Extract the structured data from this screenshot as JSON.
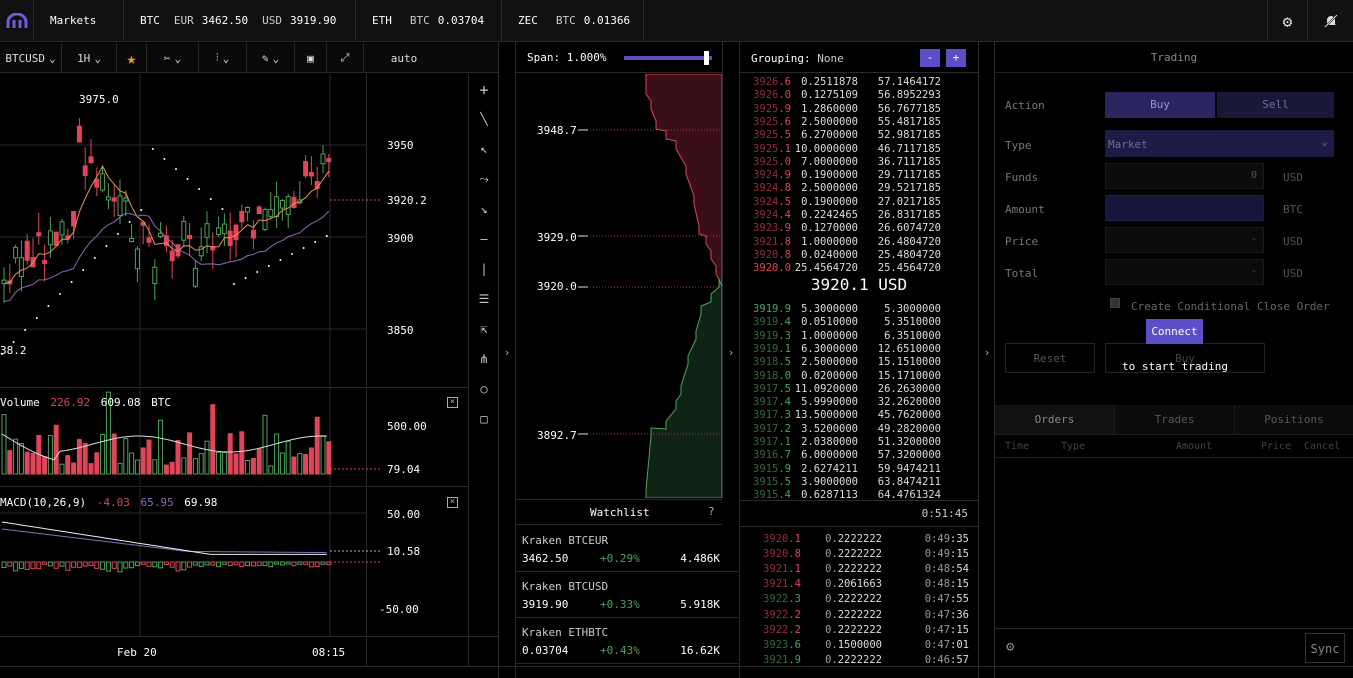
{
  "topbar": {
    "markets_label": "Markets",
    "btc": {
      "label": "BTC",
      "eur_label": "EUR",
      "eur_value": "3462.50",
      "usd_label": "USD",
      "usd_value": "3919.90"
    },
    "eth": {
      "label": "ETH",
      "btc_label": "BTC",
      "btc_value": "0.03704"
    },
    "zec": {
      "label": "ZEC",
      "btc_label": "BTC",
      "btc_value": "0.01366"
    }
  },
  "chart_toolbar": {
    "pair": "BTCUSD",
    "interval": "1H",
    "scale": "auto"
  },
  "price_chart": {
    "high_label": "3975.0",
    "low_label": "38.2",
    "axis_ticks": [
      "3950",
      "3920.2",
      "3900",
      "3850"
    ],
    "x_ticks": [
      "Feb 20",
      "08:15"
    ]
  },
  "volume": {
    "label": "Volume",
    "v1": "226.92",
    "v2": "609.08",
    "unit": "BTC",
    "ticks": [
      "500.00",
      "79.04"
    ]
  },
  "macd": {
    "label": "MACD(10,26,9)",
    "v1": "-4.03",
    "v2": "65.95",
    "v3": "69.98",
    "ticks": [
      "50.00",
      "10.58",
      "-50.00"
    ]
  },
  "depth": {
    "span_label": "Span:",
    "span_value": "1.000%",
    "ticks": [
      "3948.7",
      "3929.0",
      "3920.0",
      "3892.7"
    ]
  },
  "watchlist": {
    "title": "Watchlist",
    "help": "?",
    "items": [
      {
        "name": "Kraken BTCEUR",
        "price": "3462.50",
        "change": "+0.29%",
        "volume": "4.486K"
      },
      {
        "name": "Kraken BTCUSD",
        "price": "3919.90",
        "change": "+0.33%",
        "volume": "5.918K"
      },
      {
        "name": "Kraken ETHBTC",
        "price": "0.03704",
        "change": "+0.43%",
        "volume": "16.62K"
      }
    ]
  },
  "orderbook": {
    "grouping_label": "Grouping:",
    "grouping_value": "None",
    "minus": "-",
    "plus": "+",
    "mid_price": "3920.1 USD",
    "asks": [
      [
        "3926.6",
        "0.2511878",
        "57.1464172"
      ],
      [
        "3926.0",
        "0.1275109",
        "56.8952293"
      ],
      [
        "3925.9",
        "1.2860000",
        "56.7677185"
      ],
      [
        "3925.6",
        "2.5000000",
        "55.4817185"
      ],
      [
        "3925.5",
        "6.2700000",
        "52.9817185"
      ],
      [
        "3925.1",
        "10.0000000",
        "46.7117185"
      ],
      [
        "3925.0",
        "7.0000000",
        "36.7117185"
      ],
      [
        "3924.9",
        "0.1900000",
        "29.7117185"
      ],
      [
        "3924.8",
        "2.5000000",
        "29.5217185"
      ],
      [
        "3924.5",
        "0.1900000",
        "27.0217185"
      ],
      [
        "3924.4",
        "0.2242465",
        "26.8317185"
      ],
      [
        "3923.9",
        "0.1270000",
        "26.6074720"
      ],
      [
        "3921.8",
        "1.0000000",
        "26.4804720"
      ],
      [
        "3920.8",
        "0.0240000",
        "25.4804720"
      ],
      [
        "3920.0",
        "25.4564720",
        "25.4564720"
      ]
    ],
    "bids": [
      [
        "3919.9",
        "5.3000000",
        "5.3000000"
      ],
      [
        "3919.4",
        "0.0510000",
        "5.3510000"
      ],
      [
        "3919.3",
        "1.0000000",
        "6.3510000"
      ],
      [
        "3919.1",
        "6.3000000",
        "12.6510000"
      ],
      [
        "3918.5",
        "2.5000000",
        "15.1510000"
      ],
      [
        "3918.0",
        "0.0200000",
        "15.1710000"
      ],
      [
        "3917.5",
        "11.0920000",
        "26.2630000"
      ],
      [
        "3917.4",
        "5.9990000",
        "32.2620000"
      ],
      [
        "3917.3",
        "13.5000000",
        "45.7620000"
      ],
      [
        "3917.2",
        "3.5200000",
        "49.2820000"
      ],
      [
        "3917.1",
        "2.0380000",
        "51.3200000"
      ],
      [
        "3916.7",
        "6.0000000",
        "57.3200000"
      ],
      [
        "3915.9",
        "2.6274211",
        "59.9474211"
      ],
      [
        "3915.5",
        "3.9000000",
        "63.8474211"
      ],
      [
        "3915.4",
        "0.6287113",
        "64.4761324"
      ]
    ]
  },
  "trades": {
    "time_header": "0:51:45",
    "rows": [
      {
        "price": "3920.1",
        "amount": "0.2222222",
        "time": "0:49:35",
        "side": "sell"
      },
      {
        "price": "3920.8",
        "amount": "0.2222222",
        "time": "0:49:15",
        "side": "sell"
      },
      {
        "price": "3921.1",
        "amount": "0.2222222",
        "time": "0:48:54",
        "side": "sell"
      },
      {
        "price": "3921.4",
        "amount": "0.2061663",
        "time": "0:48:15",
        "side": "sell"
      },
      {
        "price": "3922.3",
        "amount": "0.2222222",
        "time": "0:47:55",
        "side": "buy"
      },
      {
        "price": "3922.2",
        "amount": "0.2222222",
        "time": "0:47:36",
        "side": "sell"
      },
      {
        "price": "3922.2",
        "amount": "0.2222222",
        "time": "0:47:15",
        "side": "sell"
      },
      {
        "price": "3923.6",
        "amount": "0.1500000",
        "time": "0:47:01",
        "side": "buy"
      },
      {
        "price": "3921.9",
        "amount": "0.2222222",
        "time": "0:46:57",
        "side": "buy"
      }
    ]
  },
  "trading": {
    "title": "Trading",
    "action_label": "Action",
    "buy": "Buy",
    "sell": "Sell",
    "type_label": "Type",
    "type_value": "Market",
    "funds_label": "Funds",
    "funds_value": "0",
    "funds_unit": "USD",
    "amount_label": "Amount",
    "amount_unit": "BTC",
    "price_label": "Price",
    "price_value": "-",
    "price_unit": "USD",
    "total_label": "Total",
    "total_value": "-",
    "total_unit": "USD",
    "conditional_label": "Create Conditional Close Order",
    "connect_button": "Connect",
    "connect_hint": "to start trading",
    "reset_button": "Reset",
    "buy_button": "Buy",
    "tabs": [
      "Orders",
      "Trades",
      "Positions"
    ],
    "columns": [
      "Time",
      "Type",
      "Amount",
      "Price",
      "Cancel"
    ],
    "sync_button": "Sync"
  },
  "colors": {
    "accent": "#5b4ec7",
    "ask": "#e0455a",
    "bid": "#4fa35a"
  }
}
